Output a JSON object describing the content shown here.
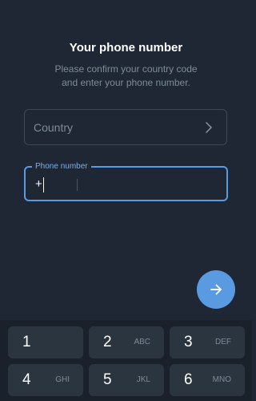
{
  "header": {
    "title": "Your phone number",
    "subtitle_line1": "Please confirm your country code",
    "subtitle_line2": "and enter your phone number."
  },
  "country": {
    "placeholder": "Country",
    "icon": "chevron-right-icon"
  },
  "phone": {
    "label": "Phone number",
    "prefix": "+",
    "value": ""
  },
  "next_button": {
    "icon": "arrow-right-icon"
  },
  "keypad": {
    "keys": [
      {
        "digit": "1",
        "letters": ""
      },
      {
        "digit": "2",
        "letters": "ABC"
      },
      {
        "digit": "3",
        "letters": "DEF"
      },
      {
        "digit": "4",
        "letters": "GHI"
      },
      {
        "digit": "5",
        "letters": "JKL"
      },
      {
        "digit": "6",
        "letters": "MNO"
      }
    ]
  },
  "colors": {
    "background": "#1e2733",
    "accent": "#5a9ae0",
    "key_background": "#2b3540",
    "secondary_text": "#7e8b98"
  }
}
